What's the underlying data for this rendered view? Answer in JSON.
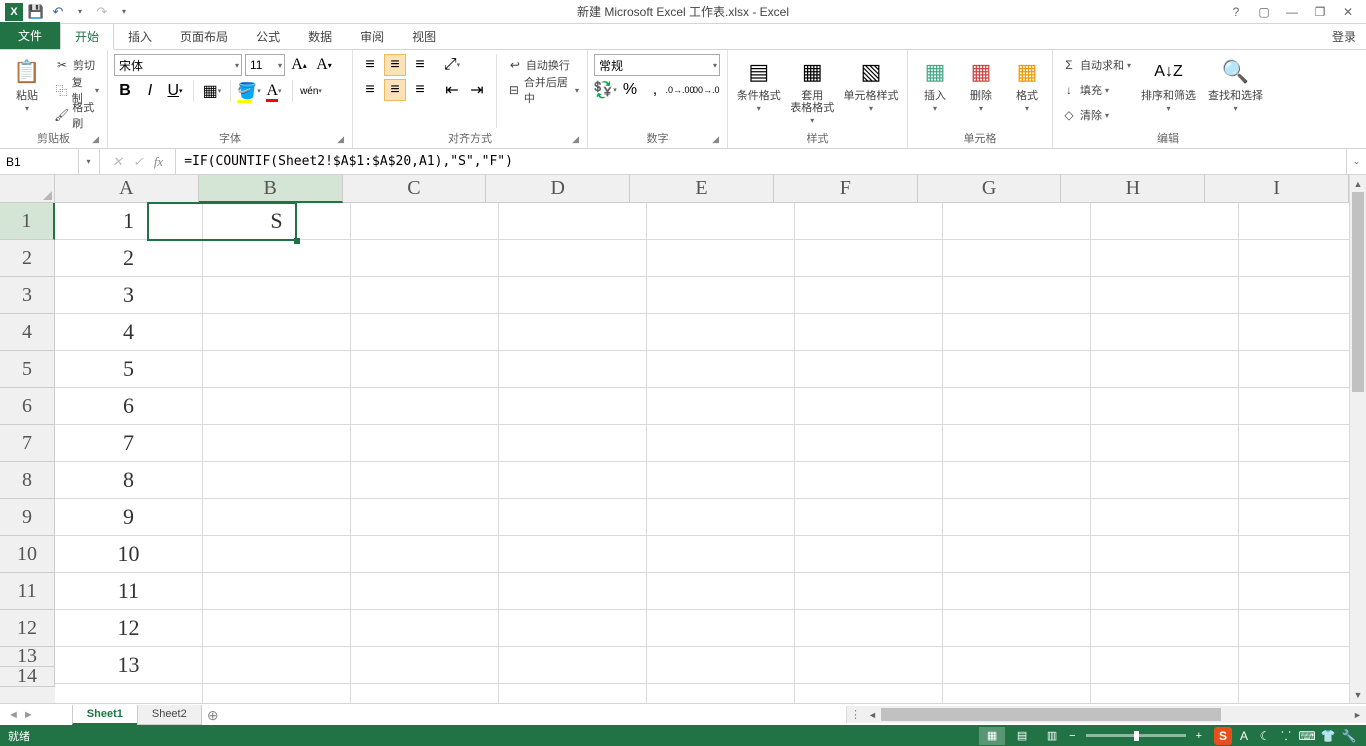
{
  "title": "新建 Microsoft Excel 工作表.xlsx - Excel",
  "tabs": {
    "file": "文件",
    "home": "开始",
    "insert": "插入",
    "layout": "页面布局",
    "formulas": "公式",
    "data": "数据",
    "review": "审阅",
    "view": "视图"
  },
  "signin": "登录",
  "clipboard": {
    "label": "剪贴板",
    "paste": "粘贴",
    "cut": "剪切",
    "copy": "复制",
    "painter": "格式刷"
  },
  "font": {
    "label": "字体",
    "name": "宋体",
    "size": "11"
  },
  "align": {
    "label": "对齐方式",
    "wrap": "自动换行",
    "merge": "合并后居中"
  },
  "number": {
    "label": "数字",
    "format": "常规"
  },
  "styles": {
    "label": "样式",
    "cond": "条件格式",
    "table": "套用\n表格格式",
    "cell": "单元格样式"
  },
  "cells": {
    "label": "单元格",
    "insert": "插入",
    "delete": "删除",
    "format": "格式"
  },
  "editing": {
    "label": "编辑",
    "sum": "自动求和",
    "fill": "填充",
    "clear": "清除",
    "sort": "排序和筛选",
    "find": "查找和选择"
  },
  "namebox": "B1",
  "formula": "=IF(COUNTIF(Sheet2!$A$1:$A$20,A1),\"S\",\"F\")",
  "columns": [
    "A",
    "B",
    "C",
    "D",
    "E",
    "F",
    "G",
    "H",
    "I"
  ],
  "rows": [
    "1",
    "2",
    "3",
    "4",
    "5",
    "6",
    "7",
    "8",
    "9",
    "10",
    "11",
    "12"
  ],
  "data_a": [
    "1",
    "2",
    "3",
    "4",
    "5",
    "6",
    "7",
    "8",
    "9",
    "10",
    "11",
    "12",
    "13"
  ],
  "cell_b1": "S",
  "sheets": {
    "s1": "Sheet1",
    "s2": "Sheet2"
  },
  "status": "就绪",
  "zoom": "100%"
}
